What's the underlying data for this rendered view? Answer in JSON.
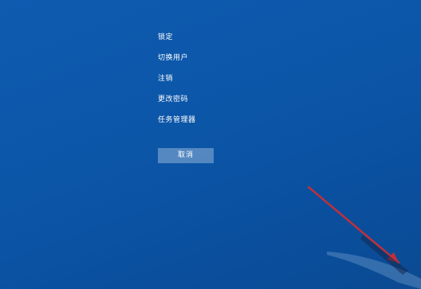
{
  "menu": {
    "items": [
      {
        "label": "锁定"
      },
      {
        "label": "切换用户"
      },
      {
        "label": "注销"
      },
      {
        "label": "更改密码"
      },
      {
        "label": "任务管理器"
      }
    ]
  },
  "cancel_button": {
    "label": "取消"
  },
  "colors": {
    "background": "#0c56a8",
    "text": "#ffffff",
    "button_bg": "rgba(255,255,255,0.30)",
    "arrow": "#c0303a"
  },
  "icons": {
    "pointer": "red-arrow-annotation"
  }
}
